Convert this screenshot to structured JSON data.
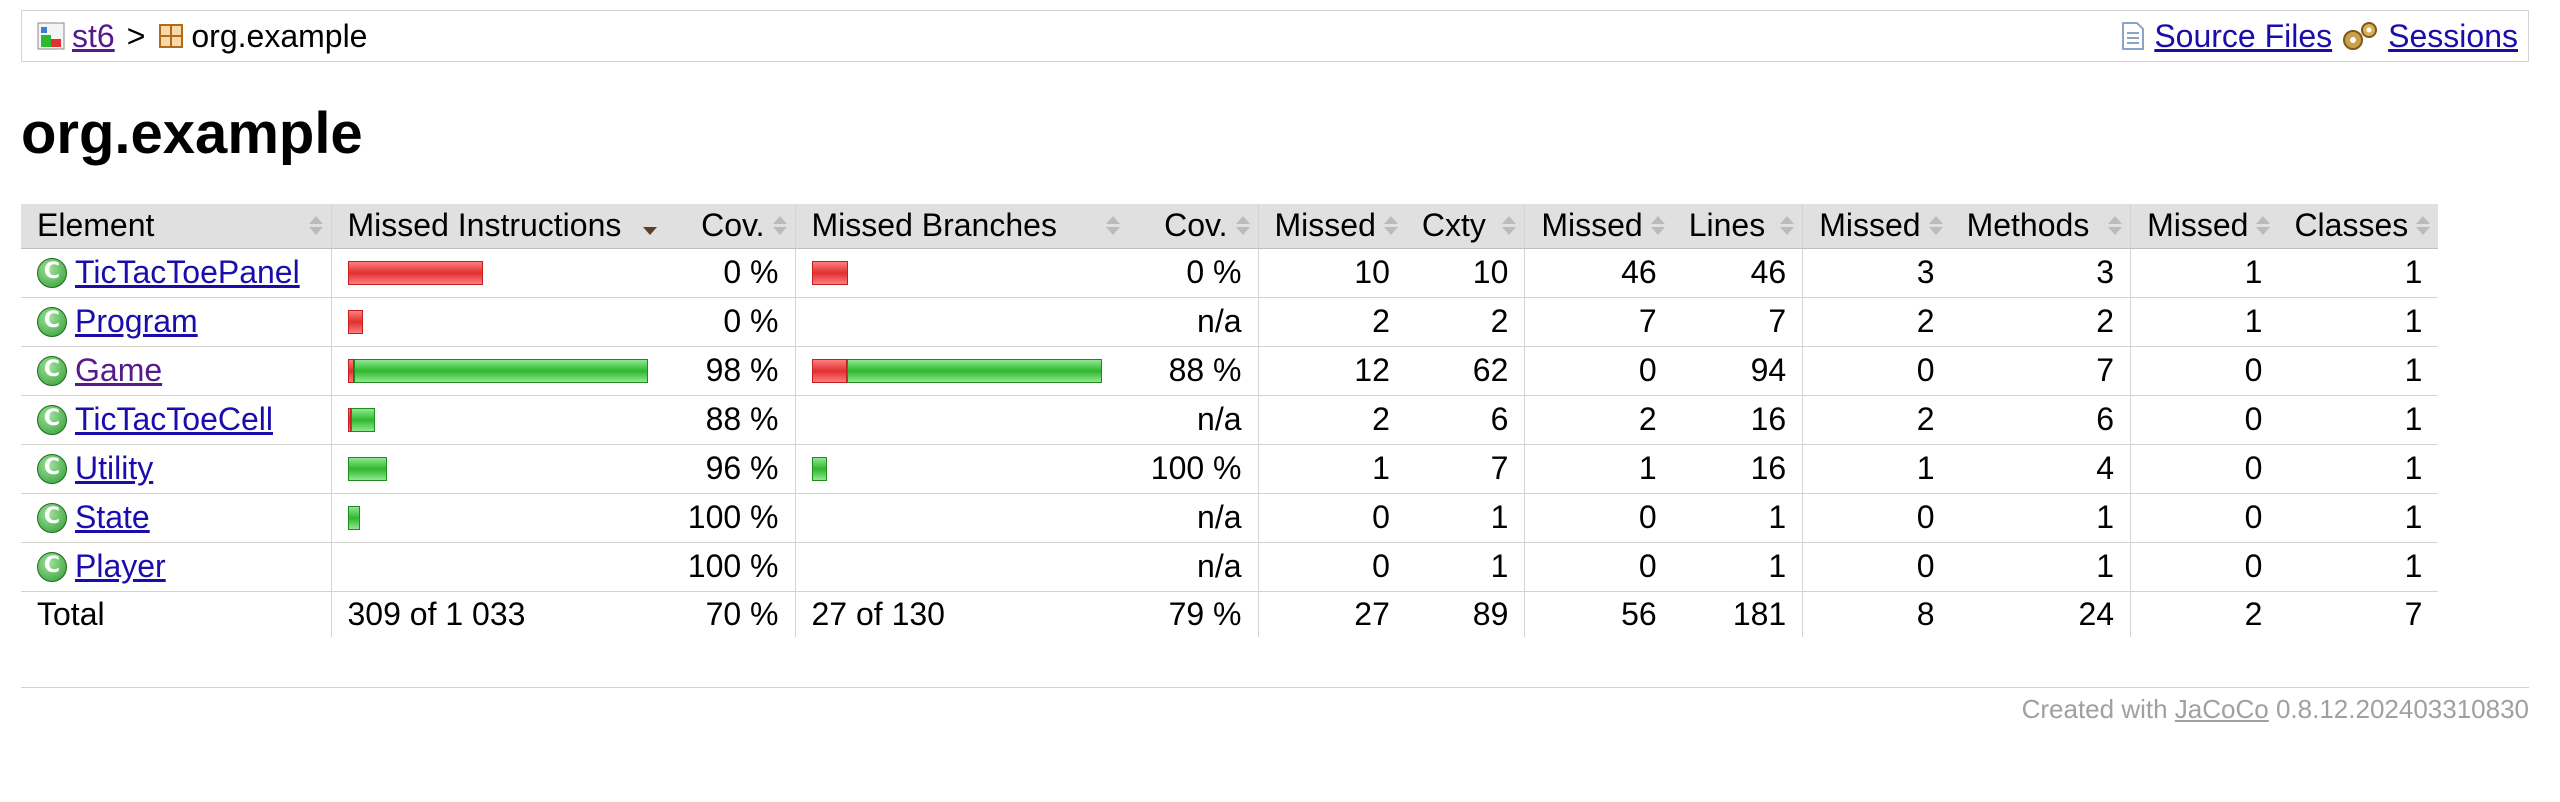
{
  "breadcrumb": {
    "session": "st6",
    "separator": ">",
    "current": "org.example",
    "source_files": "Source Files",
    "sessions": "Sessions"
  },
  "page_title": "org.example",
  "table": {
    "headers": {
      "element": "Element",
      "missed_instructions": "Missed Instructions",
      "cov1": "Cov.",
      "missed_branches": "Missed Branches",
      "cov2": "Cov.",
      "missed_cxty": "Missed",
      "cxty": "Cxty",
      "missed_lines": "Missed",
      "lines": "Lines",
      "missed_methods": "Missed",
      "methods": "Methods",
      "missed_classes": "Missed",
      "classes": "Classes"
    },
    "rows": [
      {
        "name": "TicTacToePanel",
        "ins_cov": "0 %",
        "br_cov": "0 %",
        "mcx": "10",
        "cx": "10",
        "ml": "46",
        "l": "46",
        "mm": "3",
        "m": "3",
        "mc": "1",
        "c": "1",
        "ins_red": 1.0,
        "ins_green": 0.0,
        "br_red": 1.0,
        "br_green": 0.0,
        "ins_frac": 0.45,
        "br_frac": 0.125
      },
      {
        "name": "Program",
        "ins_cov": "0 %",
        "br_cov": "n/a",
        "mcx": "2",
        "cx": "2",
        "ml": "7",
        "l": "7",
        "mm": "2",
        "m": "2",
        "mc": "1",
        "c": "1",
        "ins_red": 1.0,
        "ins_green": 0.0,
        "br_red": 0,
        "br_green": 0,
        "ins_frac": 0.05,
        "br_frac": 0
      },
      {
        "name": "Game",
        "ins_cov": "98 %",
        "br_cov": "88 %",
        "mcx": "12",
        "cx": "62",
        "ml": "0",
        "l": "94",
        "mm": "0",
        "m": "7",
        "mc": "0",
        "c": "1",
        "ins_red": 0.02,
        "ins_green": 0.98,
        "br_red": 0.12,
        "br_green": 0.88,
        "ins_frac": 1.0,
        "br_frac": 1.0
      },
      {
        "name": "TicTacToeCell",
        "ins_cov": "88 %",
        "br_cov": "n/a",
        "mcx": "2",
        "cx": "6",
        "ml": "2",
        "l": "16",
        "mm": "2",
        "m": "6",
        "mc": "0",
        "c": "1",
        "ins_red": 0.12,
        "ins_green": 0.88,
        "br_red": 0,
        "br_green": 0,
        "ins_frac": 0.09,
        "br_frac": 0
      },
      {
        "name": "Utility",
        "ins_cov": "96 %",
        "br_cov": "100 %",
        "mcx": "1",
        "cx": "7",
        "ml": "1",
        "l": "16",
        "mm": "1",
        "m": "4",
        "mc": "0",
        "c": "1",
        "ins_red": 0.0,
        "ins_green": 1.0,
        "br_red": 0.0,
        "br_green": 1.0,
        "ins_frac": 0.13,
        "br_frac": 0.05
      },
      {
        "name": "State",
        "ins_cov": "100 %",
        "br_cov": "n/a",
        "mcx": "0",
        "cx": "1",
        "ml": "0",
        "l": "1",
        "mm": "0",
        "m": "1",
        "mc": "0",
        "c": "1",
        "ins_red": 0.0,
        "ins_green": 1.0,
        "br_red": 0,
        "br_green": 0,
        "ins_frac": 0.04,
        "br_frac": 0
      },
      {
        "name": "Player",
        "ins_cov": "100 %",
        "br_cov": "n/a",
        "mcx": "0",
        "cx": "1",
        "ml": "0",
        "l": "1",
        "mm": "0",
        "m": "1",
        "mc": "0",
        "c": "1",
        "ins_red": 0,
        "ins_green": 0,
        "br_red": 0,
        "br_green": 0,
        "ins_frac": 0,
        "br_frac": 0
      }
    ],
    "total": {
      "label": "Total",
      "ins": "309 of 1 033",
      "ins_cov": "70 %",
      "br": "27 of 130",
      "br_cov": "79 %",
      "mcx": "27",
      "cx": "89",
      "ml": "56",
      "l": "181",
      "mm": "8",
      "m": "24",
      "mc": "2",
      "c": "7"
    }
  },
  "footer": {
    "prefix": "Created with",
    "tool": "JaCoCo",
    "version": "0.8.12.202403310830"
  },
  "colors": {
    "missed": "#e03030",
    "covered": "#2eb82e",
    "link": "#1a0dab"
  }
}
